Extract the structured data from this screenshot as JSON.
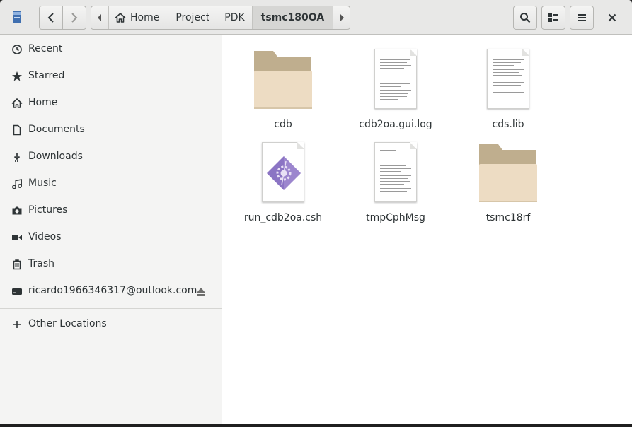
{
  "header": {
    "back_icon": "go-back-icon",
    "forward_icon": "go-forward-icon",
    "breadcrumbs": [
      "Home",
      "Project",
      "PDK",
      "tsmc180OA"
    ],
    "search_icon": "search-icon",
    "view_icon": "list-view-icon",
    "menu_icon": "hamburger-menu-icon",
    "close_icon": "close-icon"
  },
  "sidebar": {
    "items": [
      {
        "label": "Recent",
        "icon": "clock-icon"
      },
      {
        "label": "Starred",
        "icon": "star-icon"
      },
      {
        "label": "Home",
        "icon": "home-icon"
      },
      {
        "label": "Documents",
        "icon": "document-icon"
      },
      {
        "label": "Downloads",
        "icon": "download-icon"
      },
      {
        "label": "Music",
        "icon": "music-icon"
      },
      {
        "label": "Pictures",
        "icon": "camera-icon"
      },
      {
        "label": "Videos",
        "icon": "video-icon"
      },
      {
        "label": "Trash",
        "icon": "trash-icon"
      },
      {
        "label": "ricardo1966346317@outlook.com",
        "icon": "drive-icon"
      }
    ],
    "other_locations": "Other Locations"
  },
  "files": [
    {
      "name": "cdb",
      "type": "folder"
    },
    {
      "name": "cdb2oa.gui.log",
      "type": "text"
    },
    {
      "name": "cds.lib",
      "type": "text"
    },
    {
      "name": "run_cdb2oa.csh",
      "type": "script"
    },
    {
      "name": "tmpCphMsg",
      "type": "text"
    },
    {
      "name": "tsmc18rf",
      "type": "folder"
    }
  ],
  "colors": {
    "folder_back": "#bfae8e",
    "folder_front": "#eddcc3",
    "script_purple": "#8b74c4",
    "header_bg": "#e8e8e7",
    "sidebar_bg": "#f4f4f3"
  }
}
